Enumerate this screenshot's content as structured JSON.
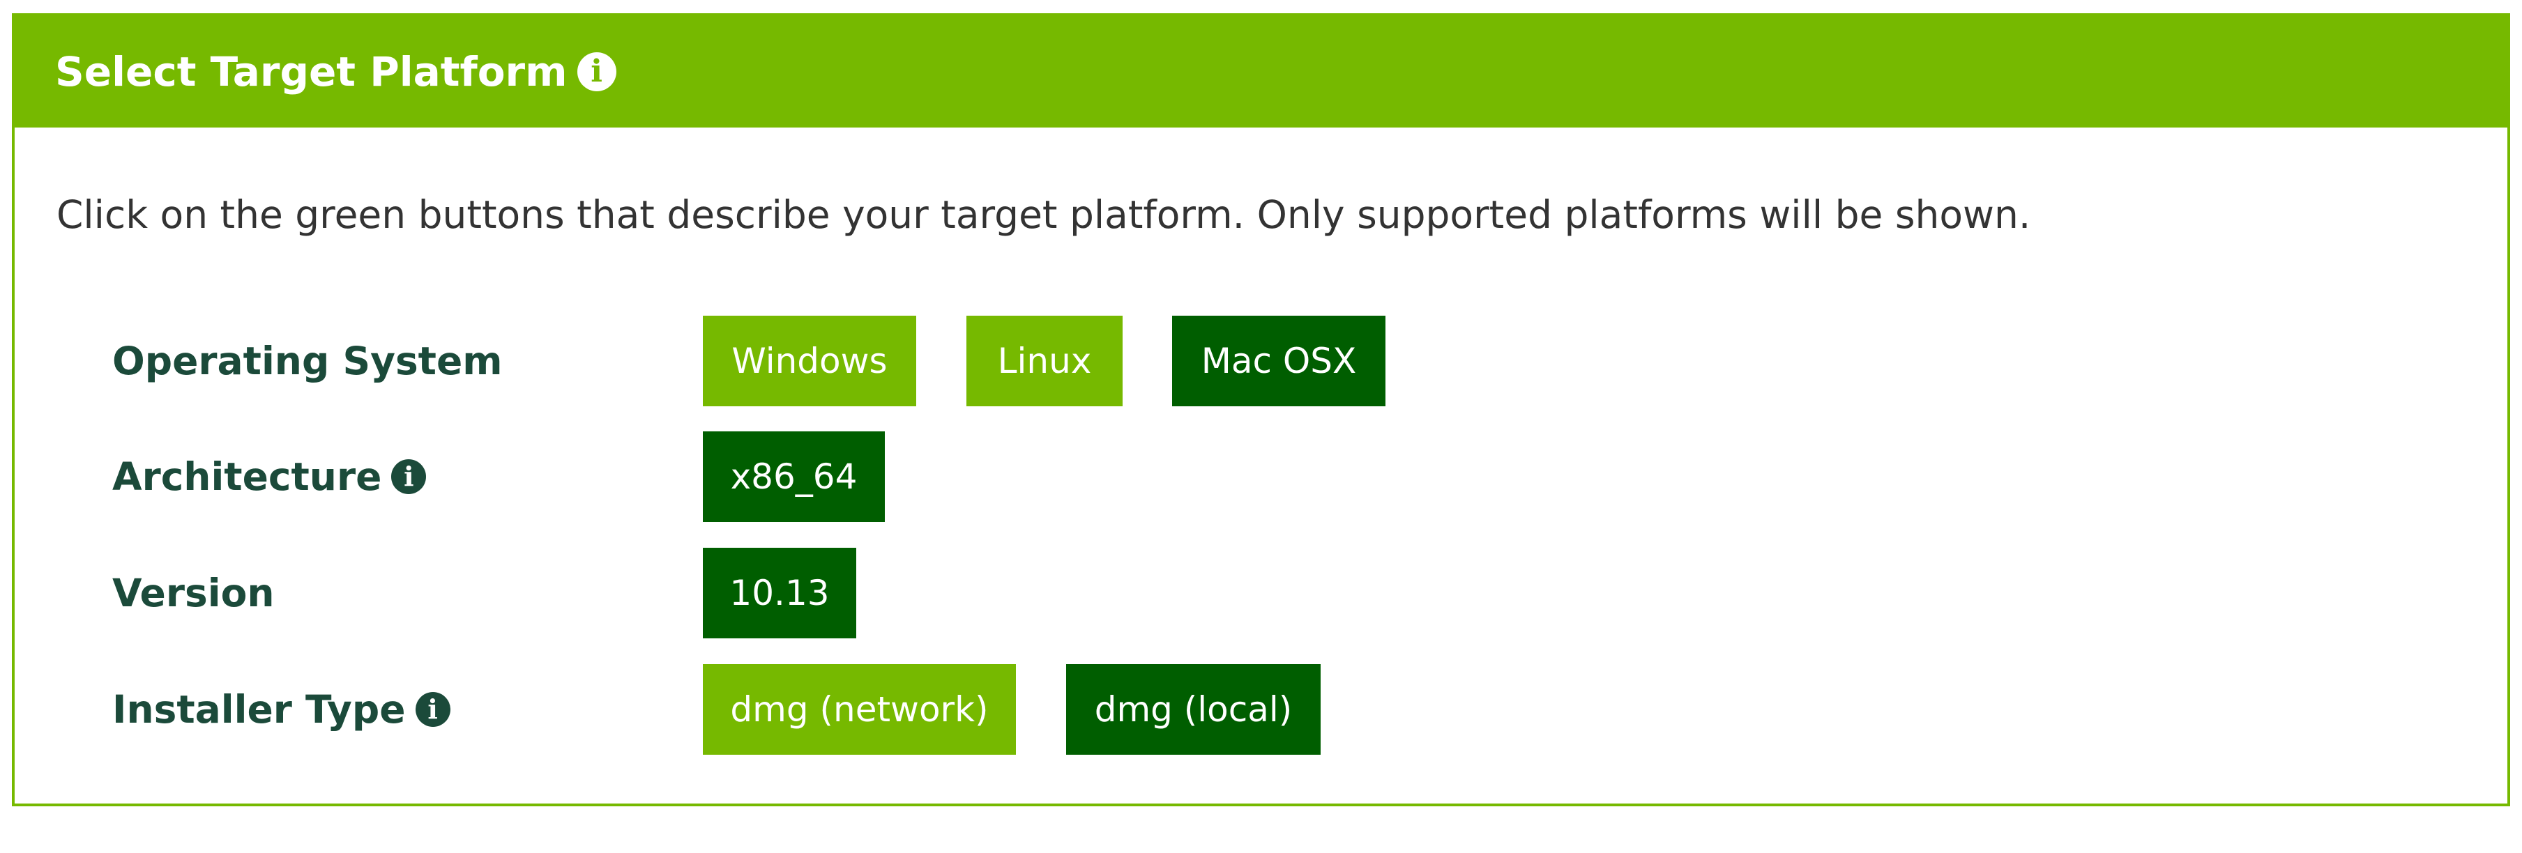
{
  "panel": {
    "title": "Select Target Platform",
    "title_icon": "info-icon",
    "intro": "Click on the green buttons that describe your target platform. Only supported platforms will be shown."
  },
  "rows": {
    "os": {
      "label": "Operating System",
      "options": [
        {
          "label": "Windows",
          "selected": false
        },
        {
          "label": "Linux",
          "selected": false
        },
        {
          "label": "Mac OSX",
          "selected": true
        }
      ]
    },
    "arch": {
      "label": "Architecture",
      "icon": "info-icon",
      "options": [
        {
          "label": "x86_64",
          "selected": true
        }
      ]
    },
    "version": {
      "label": "Version",
      "options": [
        {
          "label": "10.13",
          "selected": true
        }
      ]
    },
    "installer": {
      "label": "Installer Type",
      "icon": "info-icon",
      "options": [
        {
          "label": "dmg (network)",
          "selected": false
        },
        {
          "label": "dmg (local)",
          "selected": true
        }
      ]
    }
  },
  "colors": {
    "brand_green": "#76b900",
    "selected_green": "#005e00",
    "label_text": "#1b4a3a",
    "body_text": "#333333"
  }
}
